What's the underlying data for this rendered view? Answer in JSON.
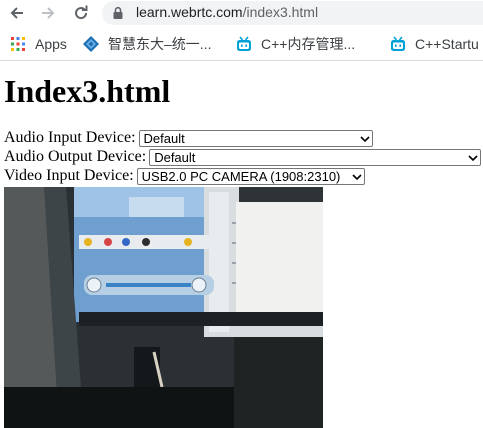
{
  "browser": {
    "url_host": "learn.webrtc.com",
    "url_path": "/index3.html",
    "icons": {
      "back": "back-arrow-icon",
      "forward": "forward-arrow-icon",
      "reload": "reload-icon",
      "lock": "lock-icon"
    }
  },
  "bookmarks": [
    {
      "label": "Apps",
      "icon": "apps-grid-icon"
    },
    {
      "label": "智慧东大–统一...",
      "icon": "diamond-logo-icon"
    },
    {
      "label": "C++内存管理...",
      "icon": "robot-favicon-icon"
    },
    {
      "label": "C++Startu",
      "icon": "robot-favicon-icon"
    }
  ],
  "page": {
    "title": "Index3.html",
    "audio_input": {
      "label": "Audio Input Device:",
      "selected": "Default"
    },
    "audio_output": {
      "label": "Audio Output Device:",
      "selected": "Default"
    },
    "video_input": {
      "label": "Video Input Device:",
      "selected": "USB2.0 PC CAMERA (1908:2310)"
    }
  },
  "colors": {
    "accent": "#1a73e8",
    "bilibili": "#00a1d6",
    "chrome_icon": "#5f6368"
  }
}
